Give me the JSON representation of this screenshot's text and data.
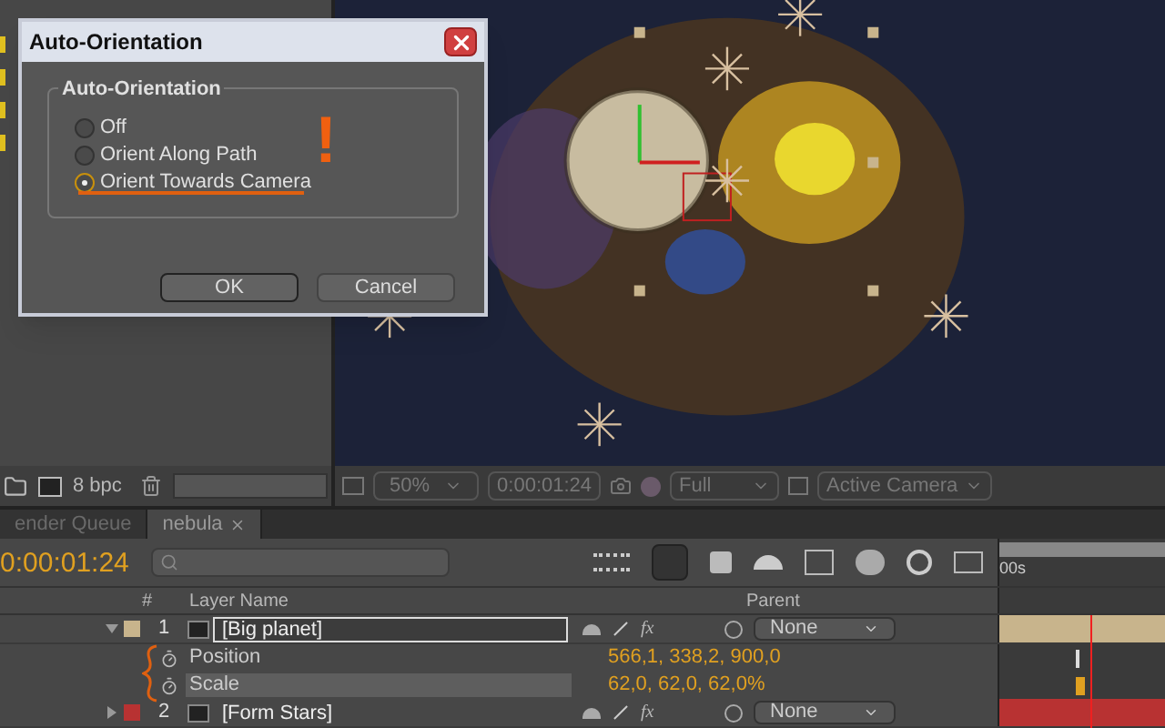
{
  "dialog": {
    "title": "Auto-Orientation",
    "group_label": "Auto-Orientation",
    "options": [
      {
        "label": "Off",
        "selected": false
      },
      {
        "label": "Orient Along Path",
        "selected": false
      },
      {
        "label": "Orient Towards Camera",
        "selected": true
      }
    ],
    "annotation": "!",
    "buttons": [
      "OK",
      "Cancel"
    ]
  },
  "project_panel": {
    "bit_depth": "8 bpc"
  },
  "viewer": {
    "zoom": "50%",
    "timecode": "0:00:01:24",
    "resolution": "Full",
    "view": "Active Camera"
  },
  "tabs": [
    {
      "label": "ender Queue",
      "selected": false,
      "closable": false
    },
    {
      "label": "nebula",
      "selected": true,
      "closable": true
    }
  ],
  "timeline": {
    "timecode": "0:00:01:24",
    "columns": [
      "#",
      "Layer Name",
      "Parent"
    ],
    "ruler_label": "00s",
    "layers": [
      {
        "number": "1",
        "name": "[Big planet]",
        "color": "#c8b48c",
        "expanded": true,
        "editing": true,
        "fx": "fx",
        "parent": "None",
        "properties": [
          {
            "name": "Position",
            "value": "566,1, 338,2, 900,0",
            "selected": false
          },
          {
            "name": "Scale",
            "value": "62,0, 62,0, 62,0%",
            "selected": true
          }
        ]
      },
      {
        "number": "2",
        "name": "[Form Stars]",
        "color": "#b83232",
        "expanded": false,
        "editing": false,
        "fx": "fx",
        "parent": "None"
      }
    ]
  }
}
